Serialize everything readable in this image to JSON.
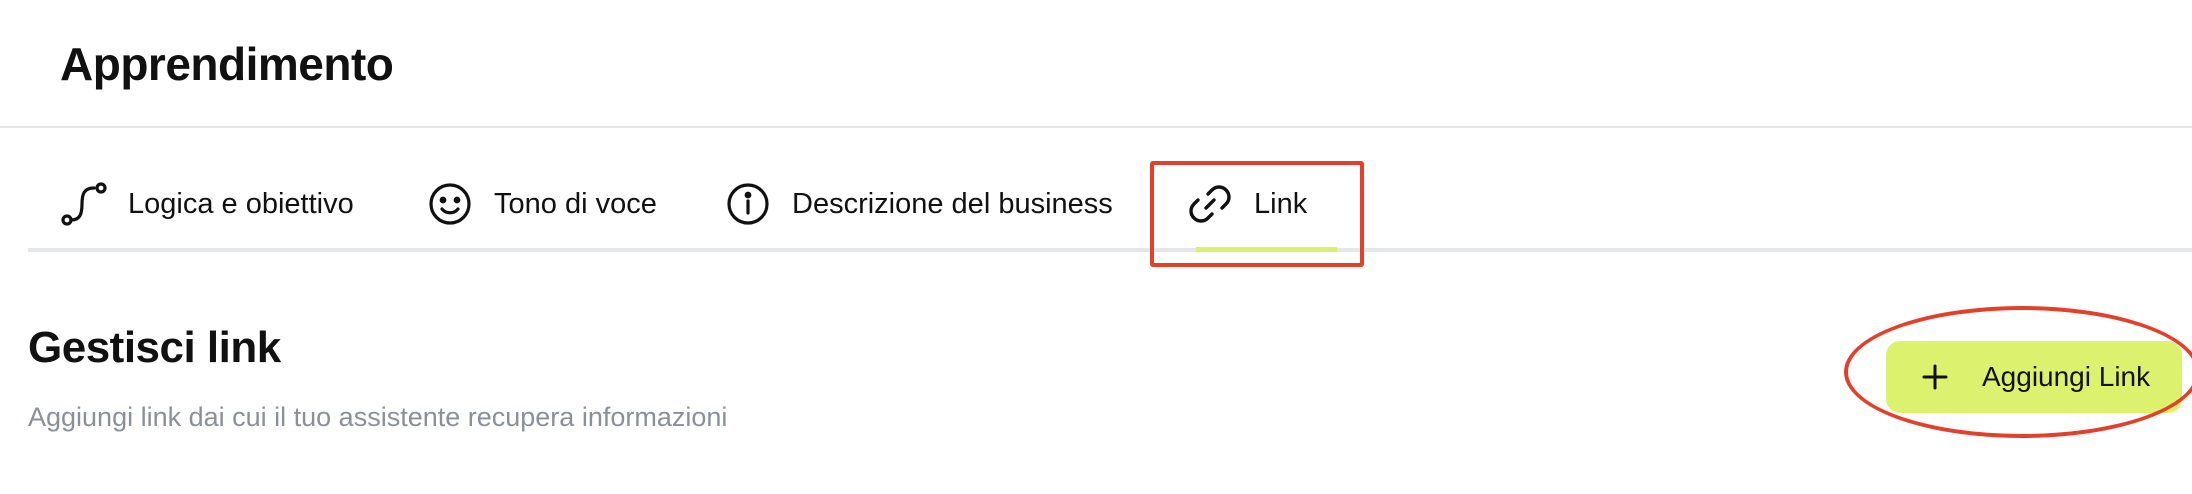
{
  "page": {
    "title": "Apprendimento"
  },
  "tabs": [
    {
      "id": "logic",
      "label": "Logica e obiettivo",
      "icon": "path-curve-icon",
      "active": false
    },
    {
      "id": "tone",
      "label": "Tono di voce",
      "icon": "smiley-icon",
      "active": false
    },
    {
      "id": "business",
      "label": "Descrizione del business",
      "icon": "info-circle-icon",
      "active": false
    },
    {
      "id": "link",
      "label": "Link",
      "icon": "link-icon",
      "active": true
    }
  ],
  "section": {
    "title": "Gestisci link",
    "subtitle": "Aggiungi link dai cui il tuo assistente recupera informazioni"
  },
  "actions": {
    "add_link_label": "Aggiungi Link",
    "add_link_icon": "plus-icon"
  },
  "colors": {
    "accent": "#dcf26e",
    "annotation": "#e2402b",
    "divider": "#e4e6ea",
    "muted_text": "#8a909a"
  }
}
